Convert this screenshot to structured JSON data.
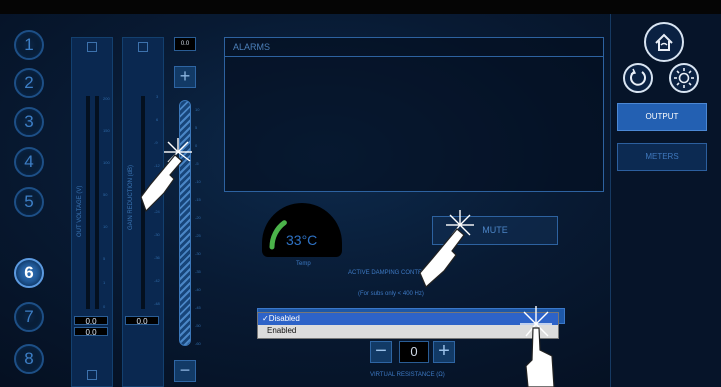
{
  "channels": [
    "1",
    "2",
    "3",
    "4",
    "5",
    "6",
    "7",
    "8"
  ],
  "active_channel": "6",
  "meters": {
    "out_voltage_label": "OUT VOLTAGE (V)",
    "gain_reduction_label": "GAIN REDUCTION (dB)",
    "out_voltage_readouts": [
      "0.0",
      "0.0"
    ],
    "gain_reduction_readout": "0.0",
    "voltage_ticks": [
      "200",
      "150",
      "100",
      "50",
      "10",
      "5",
      "1",
      "0"
    ],
    "gain_ticks": [
      "3",
      "6",
      "-9",
      "-12",
      "-18",
      "-24",
      "-30",
      "-36",
      "-42",
      "-48"
    ],
    "fader_ticks": [
      "10",
      "5",
      "0",
      "-5",
      "-10",
      "-15",
      "-20",
      "-25",
      "-30",
      "-35",
      "-40",
      "-45",
      "-50",
      "-60"
    ]
  },
  "fader": {
    "value": "0.0",
    "plus": "+",
    "minus": "−"
  },
  "alarms": {
    "title": "ALARMS"
  },
  "temp": {
    "value": "33°C",
    "label": "Temp",
    "level": 0.3
  },
  "mute": {
    "label": "MUTE"
  },
  "damping": {
    "label": "ACTIVE DAMPING CONTROL",
    "note": "(For subs only < 400 Hz)",
    "options": [
      "Disabled",
      "Enabled"
    ],
    "selected": "Disabled",
    "check": "✓"
  },
  "virtual_resistance": {
    "value": "0",
    "label": "VIRTUAL RESISTANCE (Ω)",
    "minus": "−",
    "plus": "+"
  },
  "right_panel": {
    "output_label": "OUTPUT",
    "meters_label": "METERS"
  },
  "colors": {
    "accent": "#2360b2",
    "gauge": "#4bb34a",
    "background": "#081a33"
  }
}
